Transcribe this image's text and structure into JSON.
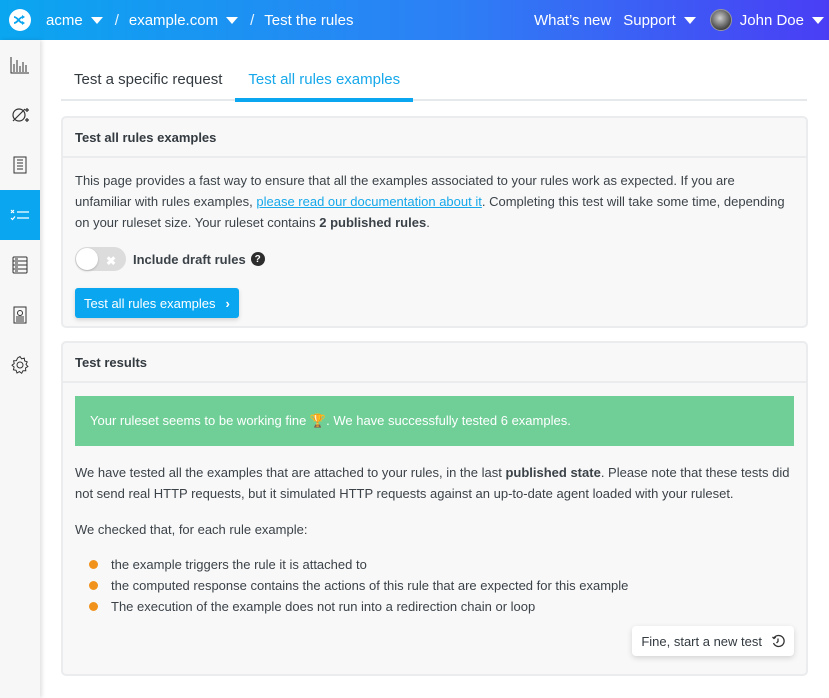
{
  "header": {
    "org": "acme",
    "domain": "example.com",
    "page": "Test the rules",
    "separator": "/",
    "whats_new": "What’s new",
    "support": "Support",
    "user": "John Doe"
  },
  "sidebar": {
    "items": [
      {
        "icon": "analytics-icon",
        "active": false
      },
      {
        "icon": "rules-editor-icon",
        "active": false
      },
      {
        "icon": "document-list-icon",
        "active": false
      },
      {
        "icon": "test-checklist-icon",
        "active": true
      },
      {
        "icon": "server-icon",
        "active": false
      },
      {
        "icon": "agent-icon",
        "active": false
      },
      {
        "icon": "gear-icon",
        "active": false
      }
    ]
  },
  "tabs": [
    {
      "label": "Test a specific request",
      "active": false
    },
    {
      "label": "Test all rules examples",
      "active": true
    }
  ],
  "test_card": {
    "title": "Test all rules examples",
    "intro_1": "This page provides a fast way to ensure that all the examples associated to your rules work as expected. If you are unfamiliar with rules examples, ",
    "doc_link": "please read our documentation about it",
    "intro_2": ". Completing this test will take some time, depending on your ruleset size. Your ruleset contains ",
    "rules_count": "2 published rules",
    "intro_3": ".",
    "toggle_label": "Include draft rules",
    "toggle_on": false,
    "help_glyph": "?",
    "button_label": "Test all rules examples"
  },
  "results_card": {
    "title": "Test results",
    "alert_1": "Your ruleset seems to be working fine ",
    "alert_emoji": "🏆",
    "alert_2": ". We have successfully tested 6 examples.",
    "para_1a": "We have tested all the examples that are attached to your rules, in the last ",
    "para_1b": "published state",
    "para_1c": ". Please note that these tests did not send real HTTP requests, but it simulated HTTP requests against an up-to-date agent loaded with your ruleset.",
    "para_2": "We checked that, for each rule example:",
    "checks": [
      "the example triggers the rule it is attached to",
      "the computed response contains the actions of this rule that are expected for this example",
      "The execution of the example does not run into a redirection chain or loop"
    ],
    "new_test_button": "Fine, start a new test"
  },
  "colors": {
    "accent": "#0aa6f0",
    "success": "#6fcf97",
    "bullet": "#f0921c"
  }
}
